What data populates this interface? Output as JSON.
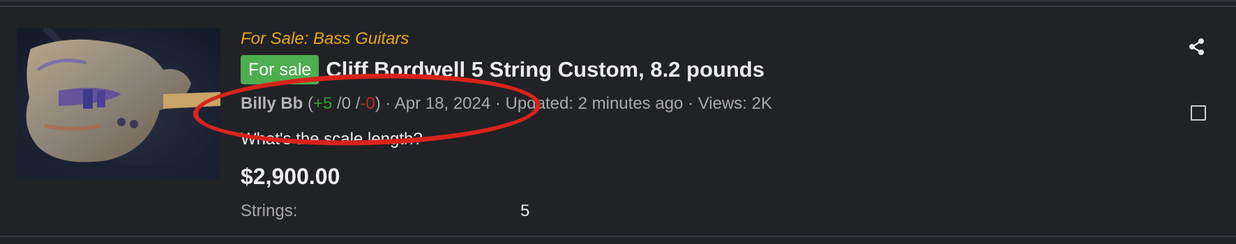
{
  "listing": {
    "forum_label": "For Sale: Bass Guitars",
    "status_badge": "For sale",
    "title": "Cliff Bordwell 5 String Custom, 8.2 pounds",
    "meta": {
      "author": "Billy Bb",
      "open_paren": " (",
      "positive": "+5",
      "neutral": " /0 /",
      "negative": "-0",
      "close_paren": ")",
      "separator_1": " · ",
      "date": "Apr 18, 2024",
      "separator_2": " · ",
      "updated": "Updated: 2 minutes ago",
      "separator_3": " · ",
      "views": "Views: 2K"
    },
    "snippet": "What's the scale length?",
    "price": "$2,900.00",
    "attributes": [
      {
        "key": "Strings:",
        "value": "5"
      }
    ]
  },
  "icons": {
    "share": "share-icon",
    "checkbox": "checkbox-icon",
    "thumbnail": "bass-guitar-photo"
  },
  "colors": {
    "background": "#212226",
    "forum_label": "#e5a619",
    "badge": "#4cae4f",
    "positive": "#2f9f2f",
    "negative": "#c52a2a",
    "annotation": "#d8231b"
  }
}
